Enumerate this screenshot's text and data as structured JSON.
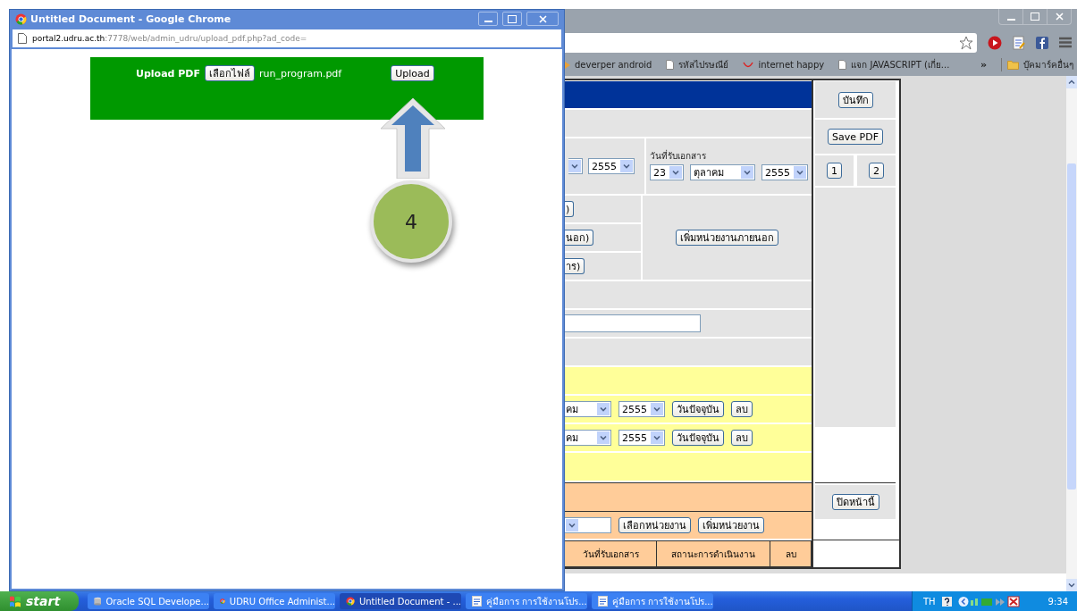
{
  "popup": {
    "title": "Untitled Document - Google Chrome",
    "url_host": "portal2.udru.ac.th",
    "url_path": ":7778/web/admin_udru/upload_pdf.php?ad_code=",
    "upload": {
      "label": "Upload PDF",
      "choose_button": "เลือกไฟล์",
      "file_name": "run_program.pdf",
      "upload_button": "Upload"
    }
  },
  "callout": {
    "number": "4"
  },
  "browser": {
    "bookmarks": [
      {
        "kind": "play",
        "label": "deverper android"
      },
      {
        "kind": "page",
        "label": "รหัสไปรษณีย์"
      },
      {
        "kind": "smile",
        "label": "internet happy"
      },
      {
        "kind": "page",
        "label": "แจก JAVASCRIPT (เกี่ย..."
      }
    ],
    "overflow": "»",
    "other_bookmarks": "บุ๊คมาร์คอื่นๆ"
  },
  "form": {
    "year_1": "2555",
    "received_label": "วันที่รับเอกสาร",
    "day": "23",
    "month": "ตุลาคม",
    "year_2": "2555",
    "cut_buttons": [
      ")",
      "นอก)",
      "าร)"
    ],
    "add_external_button": "เพิ่มหน่วยงานภายนอก",
    "date_rows": [
      {
        "month": "คม",
        "year": "2555",
        "today_button": "วันปัจจุบัน",
        "delete_button": "ลบ"
      },
      {
        "month": "คม",
        "year": "2555",
        "today_button": "วันปัจจุบัน",
        "delete_button": "ลบ"
      }
    ],
    "select_unit_button": "เลือกหน่วยงาน",
    "add_unit_button": "เพิ่มหน่วยงาน",
    "columns": [
      "วันที่รับเอกสาร",
      "สถานะการดำเนินงาน",
      "ลบ"
    ],
    "save_button": "บันทึก",
    "save_pdf_button": "Save PDF",
    "pages": [
      "1",
      "2"
    ],
    "close_button": "ปิดหน้านี้"
  },
  "taskbar": {
    "start": "start",
    "tasks": [
      {
        "kind": "database",
        "label": "Oracle SQL Develope...",
        "selected": false
      },
      {
        "kind": "chrome",
        "label": "UDRU Office Administ...",
        "selected": false
      },
      {
        "kind": "chrome",
        "label": "Untitled Document - ...",
        "selected": true
      },
      {
        "kind": "document",
        "label": "คู่มือการ การใช้งานโปร...",
        "selected": false
      },
      {
        "kind": "document",
        "label": "คู่มือการ การใช้งานโปร...",
        "selected": false
      }
    ],
    "language": "TH",
    "clock": "9:34"
  }
}
